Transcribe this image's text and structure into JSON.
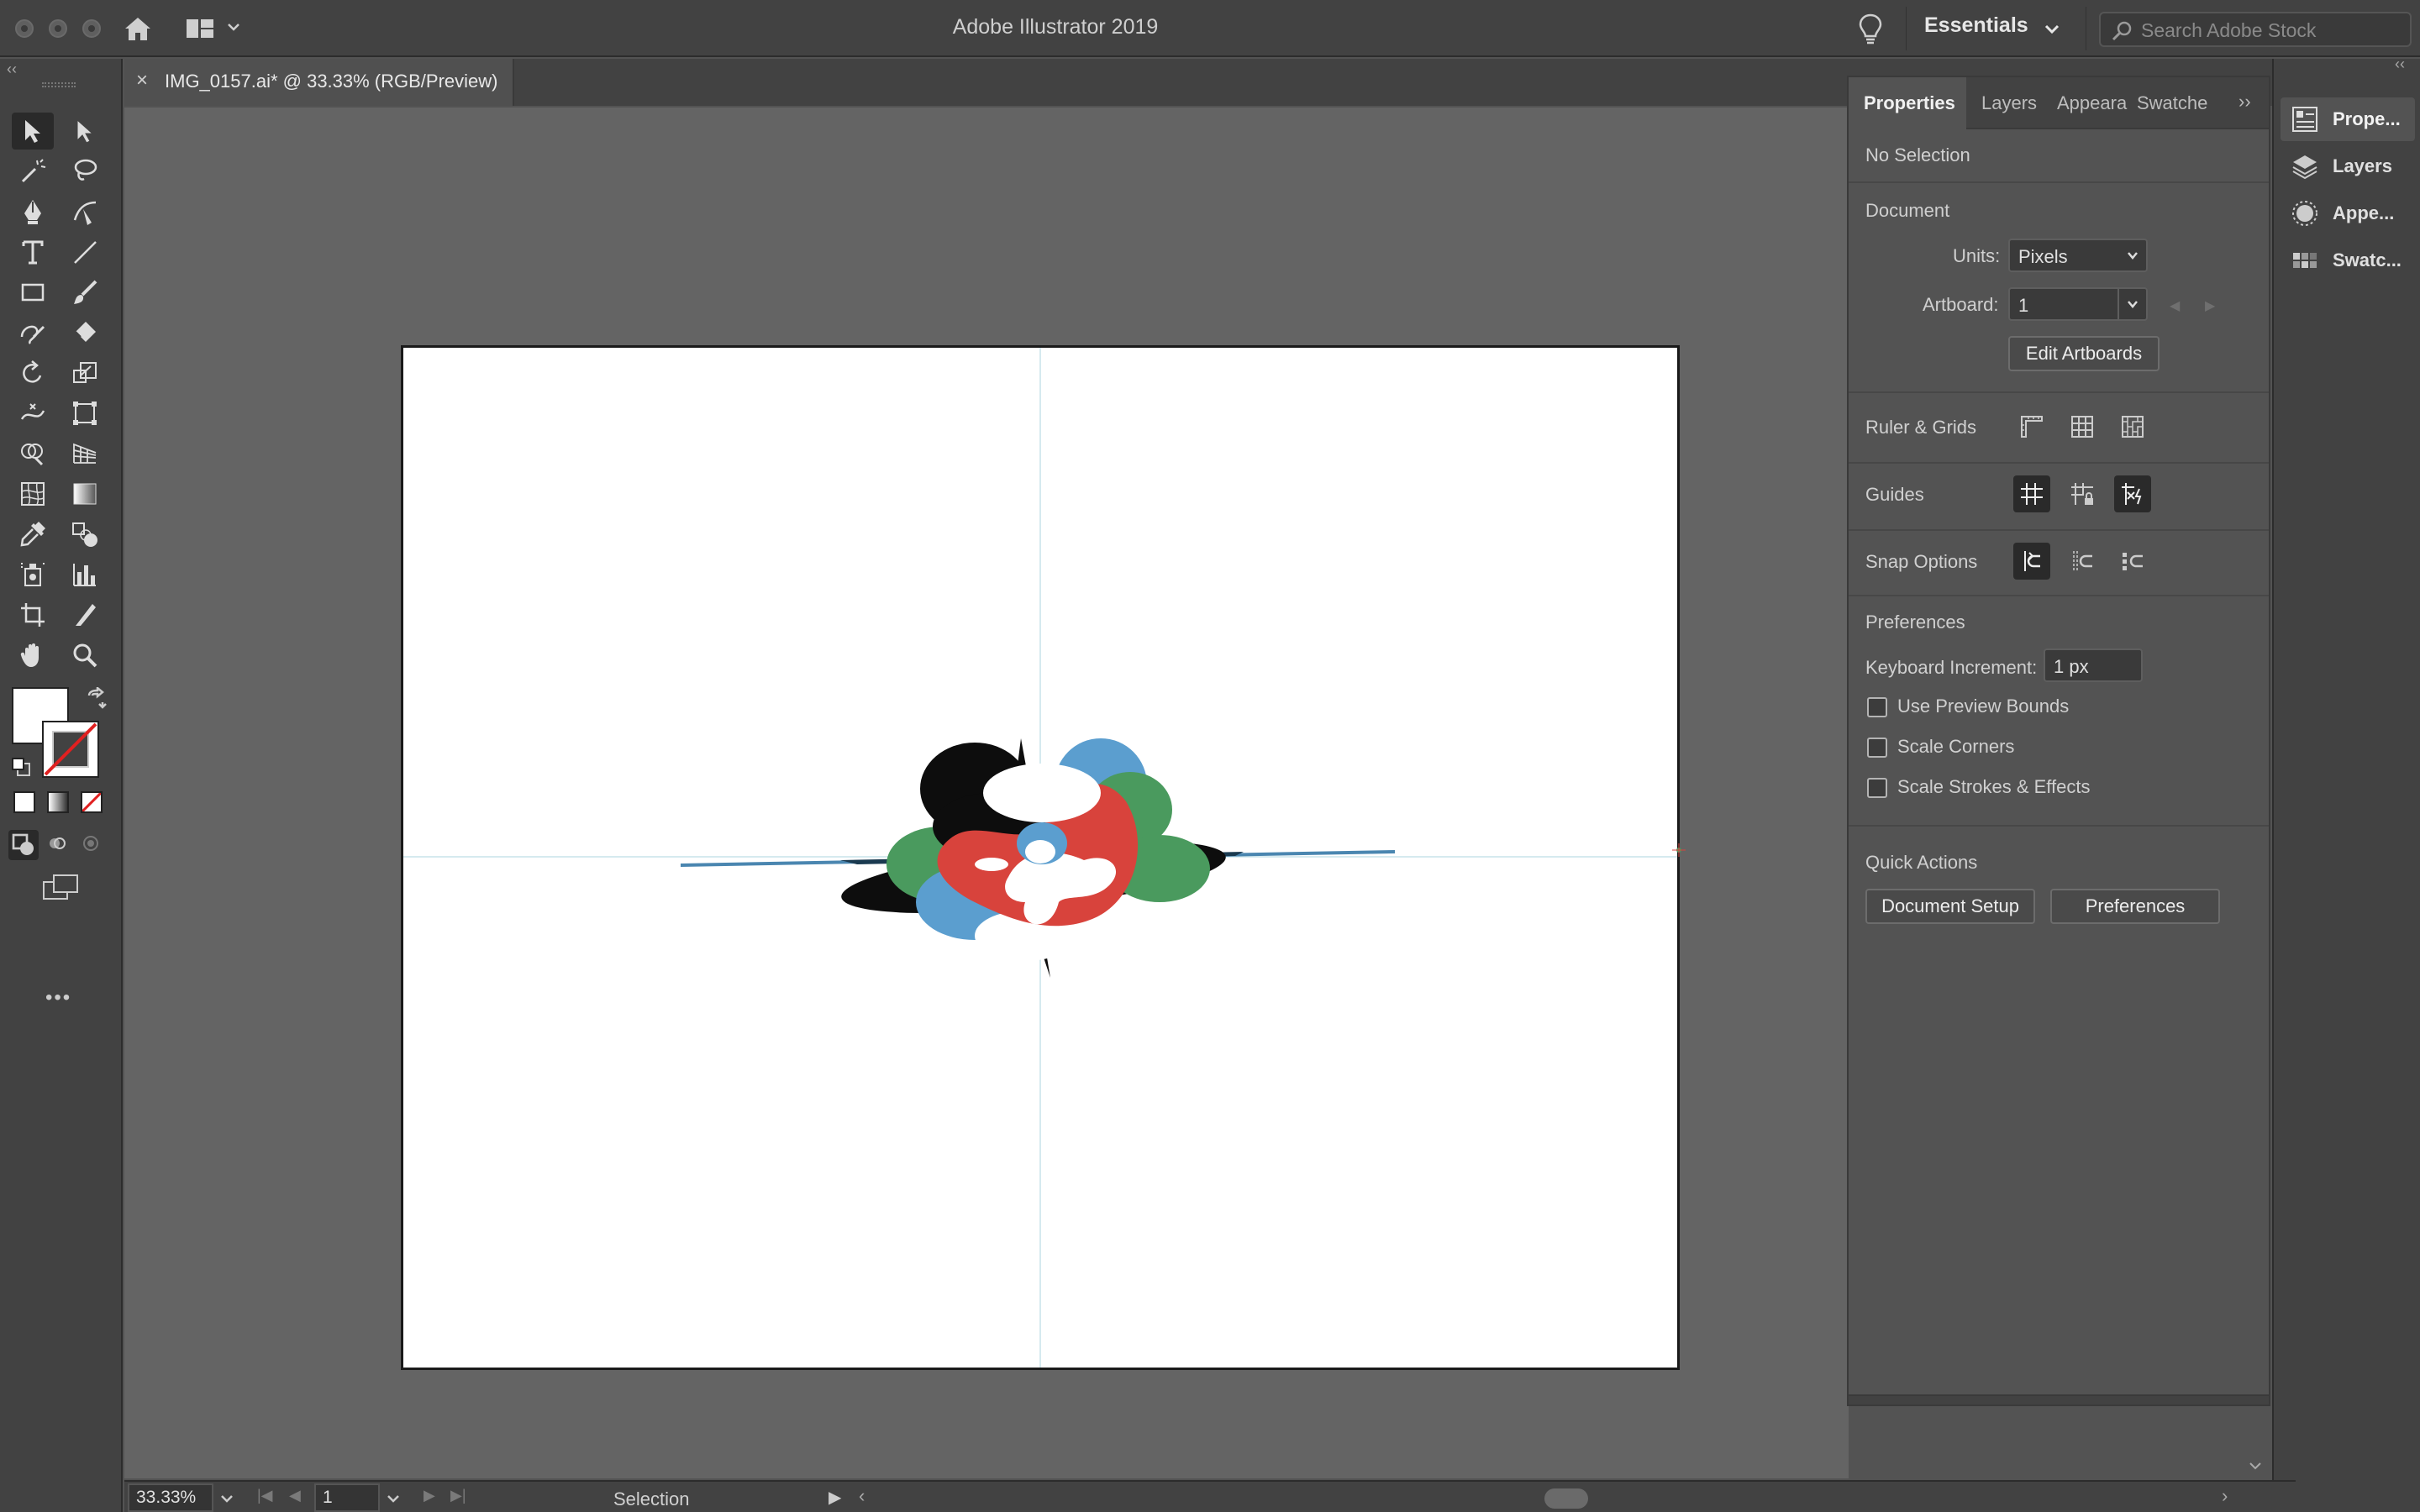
{
  "app": {
    "title": "Adobe Illustrator 2019"
  },
  "titlebar": {
    "workspace": "Essentials",
    "search_placeholder": "Search Adobe Stock"
  },
  "document": {
    "tab_label": "IMG_0157.ai* @ 33.33% (RGB/Preview)",
    "close_symbol": "×"
  },
  "toolbar": {
    "tools": [
      "selection-tool-icon",
      "direct-selection-tool-icon",
      "magic-wand-tool-icon",
      "lasso-tool-icon",
      "pen-tool-icon",
      "curvature-tool-icon",
      "type-tool-icon",
      "line-segment-tool-icon",
      "rectangle-tool-icon",
      "paintbrush-tool-icon",
      "shaper-tool-icon",
      "eraser-tool-icon",
      "rotate-tool-icon",
      "scale-tool-icon",
      "width-tool-icon",
      "free-transform-tool-icon",
      "shape-builder-tool-icon",
      "perspective-grid-tool-icon",
      "mesh-tool-icon",
      "gradient-tool-icon",
      "eyedropper-tool-icon",
      "blend-tool-icon",
      "symbol-sprayer-tool-icon",
      "column-graph-tool-icon",
      "artboard-tool-icon",
      "slice-tool-icon",
      "hand-tool-icon",
      "zoom-tool-icon"
    ],
    "more_label": "•••"
  },
  "properties": {
    "tabs": [
      "Properties",
      "Layers",
      "Appeara",
      "Swatche"
    ],
    "active_tab": "Properties",
    "selection_status": "No Selection",
    "document_section": "Document",
    "units_label": "Units:",
    "units_value": "Pixels",
    "artboard_label": "Artboard:",
    "artboard_value": "1",
    "edit_artboards_button": "Edit Artboards",
    "ruler_grids_label": "Ruler & Grids",
    "guides_label": "Guides",
    "snap_options_label": "Snap Options",
    "preferences_section": "Preferences",
    "keyboard_increment_label": "Keyboard Increment:",
    "keyboard_increment_value": "1 px",
    "checkboxes": [
      {
        "label": "Use Preview Bounds",
        "checked": false
      },
      {
        "label": "Scale Corners",
        "checked": false
      },
      {
        "label": "Scale Strokes & Effects",
        "checked": false
      }
    ],
    "quick_actions_label": "Quick Actions",
    "document_setup_button": "Document Setup",
    "preferences_button": "Preferences"
  },
  "dock": {
    "items": [
      {
        "label": "Prope...",
        "icon": "properties-icon"
      },
      {
        "label": "Layers",
        "icon": "layers-icon"
      },
      {
        "label": "Appe...",
        "icon": "appearance-icon"
      },
      {
        "label": "Swatc...",
        "icon": "swatches-icon"
      }
    ]
  },
  "statusbar": {
    "zoom": "33.33%",
    "artboard_number": "1",
    "tool_status": "Selection"
  },
  "colors": {
    "artwork_red": "#d8433c",
    "artwork_blue": "#5b9ecf",
    "artwork_green": "#4a9a5e",
    "artwork_black": "#0d0d0d",
    "fill": "#ffffff",
    "stroke": "none"
  }
}
